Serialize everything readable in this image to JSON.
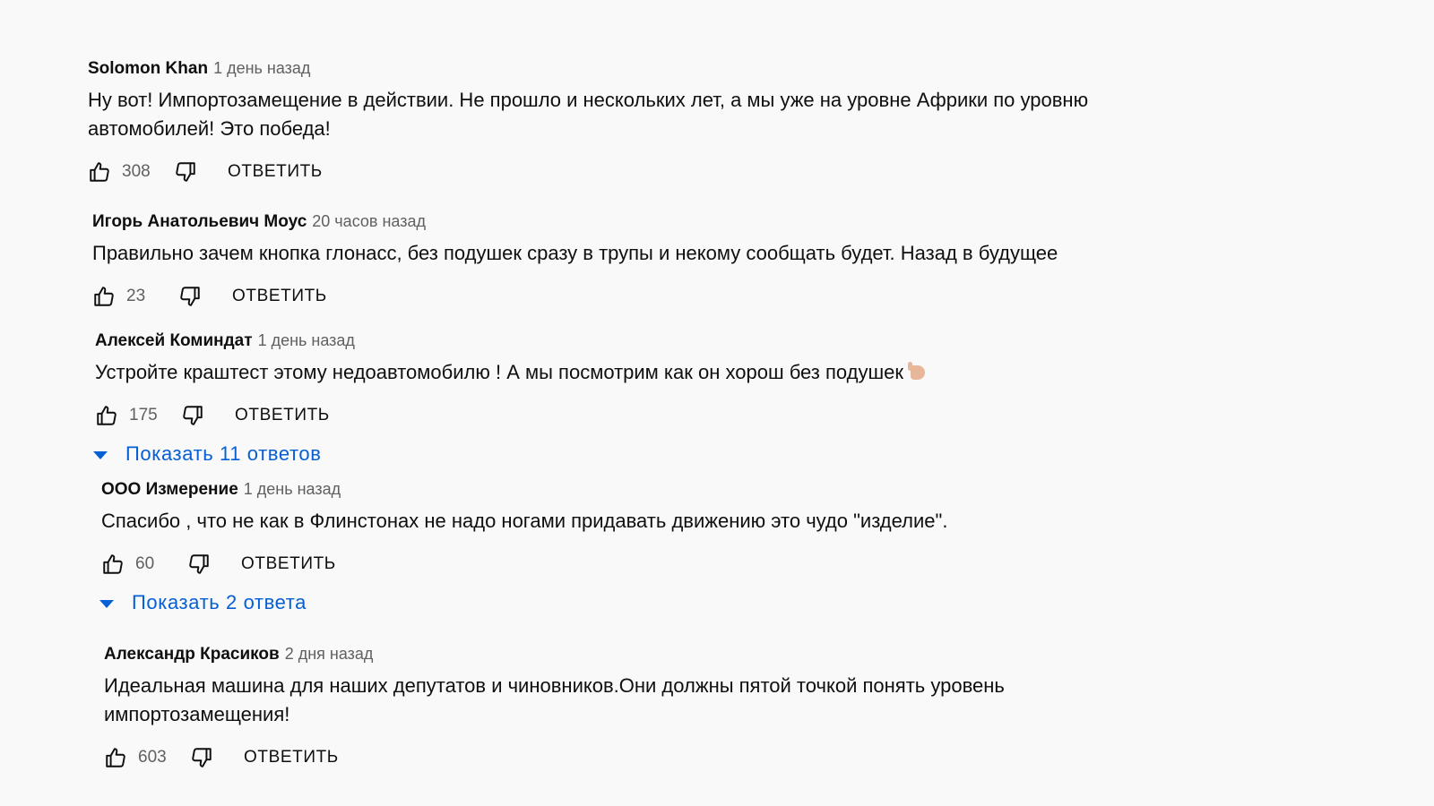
{
  "comments": [
    {
      "author": "Solomon Khan",
      "time": "1 день назад",
      "text": "Ну вот! Импортозамещение в действии. Не прошло и нескольких лет, а мы уже на уровне Африки по уровню автомобилей! Это победа!",
      "likes": "308",
      "reply_label": "ОТВЕТИТЬ"
    },
    {
      "author": "Игорь Анатольевич Моус",
      "time": "20 часов назад",
      "text": "Правильно зачем кнопка глонасс, без подушек сразу в трупы и некому сообщать будет. Назад в будущее",
      "likes": "23",
      "reply_label": "ОТВЕТИТЬ"
    },
    {
      "author": "Алексей Коминдат",
      "time": "1 день назад",
      "text": "Устройте краштест этому недоавтомобилю ! А мы посмотрим как он хорош без подушек",
      "emoji": "pointing-hand-emoji",
      "likes": "175",
      "reply_label": "ОТВЕТИТЬ",
      "show_replies": "Показать 11 ответов"
    },
    {
      "author": "ООО Измерение",
      "time": "1 день назад",
      "text": "Спасибо , что не как в Флинстонах не надо ногами придавать движению это чудо \"изделие\".",
      "likes": "60",
      "reply_label": "ОТВЕТИТЬ",
      "show_replies": "Показать 2 ответа"
    },
    {
      "author": "Александр Красиков",
      "time": "2 дня назад",
      "text": "Идеальная машина для наших депутатов и чиновников.Они должны пятой точкой понять уровень импортозамещения!",
      "likes": "603",
      "reply_label": "ОТВЕТИТЬ"
    }
  ],
  "colors": {
    "background": "#f9f9f9",
    "text": "#0f0f0f",
    "secondary_text": "#606060",
    "link_blue": "#065fd4"
  },
  "icons": {
    "like": "thumbs-up-icon",
    "dislike": "thumbs-down-icon",
    "expand": "caret-down-icon"
  }
}
